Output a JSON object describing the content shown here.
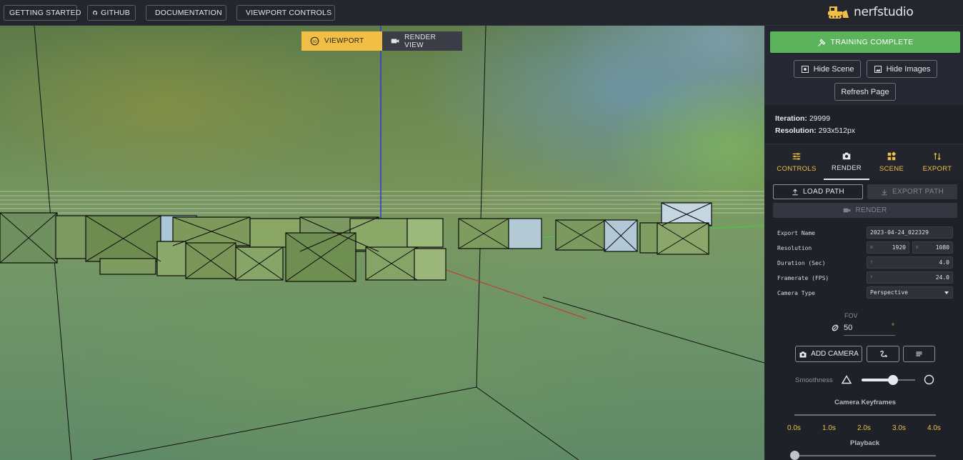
{
  "topbar": {
    "buttons": [
      {
        "label": "GETTING STARTED",
        "icon": "none"
      },
      {
        "label": "GITHUB",
        "icon": "github-icon"
      },
      {
        "label": "DOCUMENTATION",
        "icon": "document-icon"
      },
      {
        "label": "VIEWPORT CONTROLS",
        "icon": "keyboard-icon"
      }
    ],
    "logo_text": "nerfstudio"
  },
  "viewport": {
    "tabs": [
      {
        "label": "VIEWPORT",
        "icon": "3d-rotation-icon",
        "active": true
      },
      {
        "label": "RENDER VIEW",
        "icon": "video-camera-icon",
        "active": false
      }
    ]
  },
  "panel": {
    "training_button": "TRAINING COMPLETE",
    "hide_scene": "Hide Scene",
    "hide_images": "Hide Images",
    "refresh_page": "Refresh Page",
    "iteration_label": "Iteration:",
    "iteration_value": "29999",
    "resolution_label": "Resolution:",
    "resolution_value": "293x512px",
    "tabs": [
      {
        "label": "CONTROLS",
        "icon": "sliders-icon",
        "active": false
      },
      {
        "label": "RENDER",
        "icon": "camera-icon",
        "active": true
      },
      {
        "label": "SCENE",
        "icon": "widgets-icon",
        "active": false
      },
      {
        "label": "EXPORT",
        "icon": "import-export-icon",
        "active": false
      }
    ],
    "load_path": "LOAD PATH",
    "export_path": "EXPORT PATH",
    "render": "RENDER",
    "fields": {
      "export_name_label": "Export Name",
      "export_name_value": "2023-04-24_022329",
      "resolution_label": "Resolution",
      "res_w_hint": "W",
      "res_w": "1920",
      "res_h_hint": "H",
      "res_h": "1080",
      "duration_label": "Duration (Sec)",
      "duration_hint": "Y",
      "duration": "4.0",
      "framerate_label": "Framerate (FPS)",
      "framerate_hint": "Y",
      "framerate": "24.0",
      "camera_type_label": "Camera Type",
      "camera_type": "Perspective"
    },
    "fov_label": "FOV",
    "fov_value": "50",
    "fov_unit": "°",
    "add_camera": "ADD CAMERA",
    "smoothness_label": "Smoothness",
    "smoothness_level": 0.6,
    "keyframes_label": "Camera Keyframes",
    "keyframe_ticks": [
      "0.0s",
      "1.0s",
      "2.0s",
      "3.0s",
      "4.0s"
    ],
    "playback_label": "Playback"
  },
  "colors": {
    "accent_yellow": "#f2bf46",
    "success_green": "#5cb35c",
    "panel_bg": "#1e2128"
  }
}
